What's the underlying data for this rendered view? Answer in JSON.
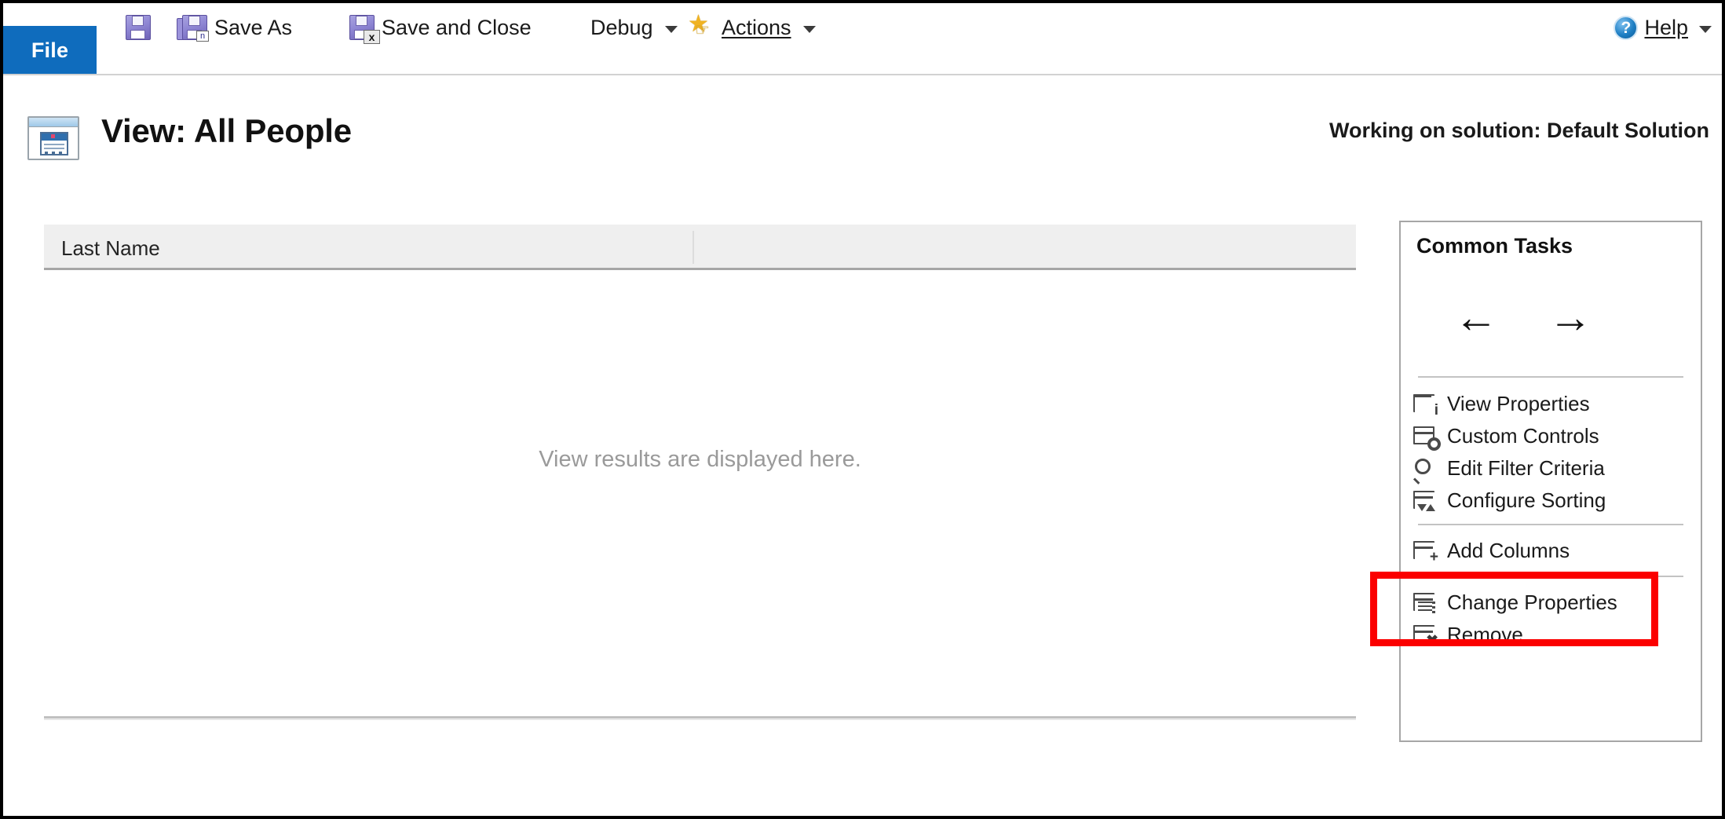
{
  "ribbon": {
    "file_tab": "File",
    "buttons": [
      {
        "name": "save",
        "label": "",
        "icon": "save-floppy-icon"
      },
      {
        "name": "save-as",
        "label": "Save As",
        "icon": "save-as-floppy-icon"
      },
      {
        "name": "save-and-close",
        "label": "Save and Close",
        "icon": "save-and-close-floppy-icon"
      },
      {
        "name": "debug",
        "label": "Debug",
        "icon": "chevron-down-icon"
      },
      {
        "name": "actions",
        "label": "Actions",
        "icon": "star-hand-icon"
      }
    ],
    "help": {
      "label": "Help",
      "icon": "help-circle-icon"
    }
  },
  "header": {
    "page_title": "View: All People",
    "view_icon": "view-window-icon",
    "solution_label": "Working on solution: Default Solution"
  },
  "grid": {
    "columns": [
      "Last Name",
      ""
    ],
    "empty_message": "View results are displayed here."
  },
  "tasks_panel": {
    "title": "Common Tasks",
    "nav": {
      "back": "←",
      "forward": "→",
      "back_name": "move-left-arrow",
      "forward_name": "move-right-arrow"
    },
    "items": [
      {
        "label": "View Properties",
        "icon": "view-properties-icon"
      },
      {
        "label": "Custom Controls",
        "icon": "custom-controls-icon"
      },
      {
        "label": "Edit Filter Criteria",
        "icon": "magnifier-icon"
      },
      {
        "label": "Configure Sorting",
        "icon": "sort-icon"
      },
      {
        "label": "Add Columns",
        "icon": "add-column-icon"
      },
      {
        "label": "Change Properties",
        "icon": "change-properties-icon"
      },
      {
        "label": "Remove",
        "icon": "remove-column-icon"
      }
    ]
  },
  "annotation": {
    "highlight_target": "Add Columns",
    "highlight_color": "#fb0000"
  },
  "colors": {
    "file_tab_blue": "#0f6cbd",
    "grid_header": "#efefef",
    "panel_border": "#a6a6a6",
    "muted_text": "#9a9a9a"
  }
}
